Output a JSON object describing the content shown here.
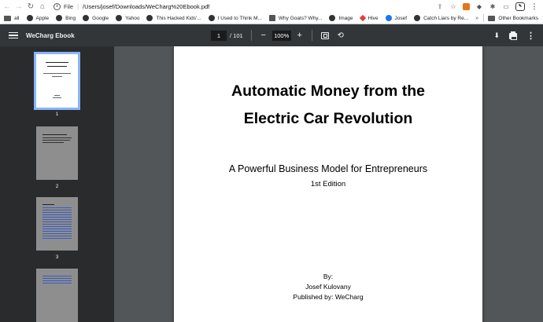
{
  "browser": {
    "address": {
      "file_chip": "File",
      "url": "/Users/josef/Downloads/WeCharg%20Ebook.pdf"
    },
    "bookmarks": [
      {
        "label": "all",
        "icon": "folder-icon"
      },
      {
        "label": "Apple",
        "icon": "globe-icon"
      },
      {
        "label": "Bing",
        "icon": "globe-icon"
      },
      {
        "label": "Google",
        "icon": "globe-icon"
      },
      {
        "label": "Yahoo",
        "icon": "globe-icon"
      },
      {
        "label": "This Hacked Kids'...",
        "icon": "globe-icon"
      },
      {
        "label": "I Used to Think M...",
        "icon": "globe-icon"
      },
      {
        "label": "Why Goats? Why...",
        "icon": "goat-icon"
      },
      {
        "label": "Image",
        "icon": "globe-icon"
      },
      {
        "label": "Hive",
        "icon": "hive-icon"
      },
      {
        "label": "Josef",
        "icon": "facebook-icon"
      },
      {
        "label": "Catch Liars by Re...",
        "icon": "globe-icon"
      }
    ],
    "more_bookmarks": "»",
    "other_bookmarks": "Other Bookmarks"
  },
  "viewer": {
    "doc_title": "WeCharg Ebook",
    "current_page": "1",
    "total_pages": "/ 101",
    "zoom": "100%",
    "zoom_out": "−",
    "zoom_in": "+"
  },
  "thumbnails": [
    {
      "number": "1",
      "active": true
    },
    {
      "number": "2",
      "active": false
    },
    {
      "number": "3",
      "active": false
    },
    {
      "number": "4",
      "active": false
    }
  ],
  "page": {
    "title_line1": "Automatic Money from the",
    "title_line2": "Electric Car Revolution",
    "subtitle": "A Powerful Business Model for Entrepreneurs",
    "edition": "1st Edition",
    "by": "By:",
    "author": "Josef Kulovany",
    "publisher": "Published by: WeCharg"
  },
  "colors": {
    "toolbar": "#323639",
    "sidebar": "#292b2d",
    "canvas": "#525659",
    "thumb_highlight": "#8ab4f8"
  }
}
